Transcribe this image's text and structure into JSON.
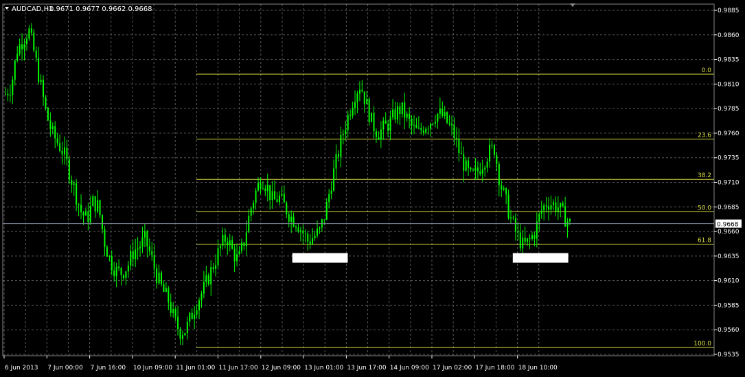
{
  "header": {
    "symbol": "AUDCAD,H1",
    "quote": "0.9671 0.9677 0.9662 0.9668"
  },
  "colors": {
    "background": "#000000",
    "grid": "#5a5a5a",
    "candles": "#00ff00",
    "fibo": "#e0e040",
    "axis_text": "#ffffff",
    "price_line": "#7d8a9a",
    "marker": "#ffffff"
  },
  "chart_data": {
    "type": "candlestick",
    "title": "",
    "ylim": [
      0.9535,
      0.9885
    ],
    "y_ticks": [
      "0.9885",
      "0.9860",
      "0.9835",
      "0.9810",
      "0.9785",
      "0.9760",
      "0.9735",
      "0.9710",
      "0.9685",
      "0.9660",
      "0.9635",
      "0.9610",
      "0.9585",
      "0.9560",
      "0.9535"
    ],
    "x_tick_labels": [
      "6 Jun 2013",
      "7 Jun 00:00",
      "7 Jun 16:00",
      "10 Jun 09:00",
      "11 Jun 01:00",
      "11 Jun 17:00",
      "12 Jun 09:00",
      "13 Jun 01:00",
      "13 Jun 17:00",
      "14 Jun 09:00",
      "17 Jun 02:00",
      "17 Jun 18:00",
      "18 Jun 10:00"
    ],
    "current_price": "0.9668",
    "price_path": [
      0.98,
      0.9808,
      0.9845,
      0.9855,
      0.9865,
      0.984,
      0.981,
      0.978,
      0.976,
      0.975,
      0.974,
      0.972,
      0.97,
      0.968,
      0.9672,
      0.969,
      0.9685,
      0.965,
      0.963,
      0.962,
      0.9618,
      0.9625,
      0.964,
      0.9645,
      0.9652,
      0.9635,
      0.9615,
      0.96,
      0.959,
      0.957,
      0.9558,
      0.956,
      0.9575,
      0.959,
      0.96,
      0.9615,
      0.963,
      0.9645,
      0.9655,
      0.964,
      0.963,
      0.965,
      0.968,
      0.97,
      0.9715,
      0.9705,
      0.969,
      0.9695,
      0.9685,
      0.9675,
      0.967,
      0.966,
      0.965,
      0.9655,
      0.966,
      0.968,
      0.971,
      0.9735,
      0.976,
      0.978,
      0.98,
      0.981,
      0.979,
      0.977,
      0.976,
      0.9765,
      0.977,
      0.978,
      0.9785,
      0.9775,
      0.9765,
      0.976,
      0.9768,
      0.9772,
      0.978,
      0.9778,
      0.977,
      0.976,
      0.974,
      0.9725,
      0.9715,
      0.972,
      0.973,
      0.974,
      0.9745,
      0.971,
      0.969,
      0.967,
      0.9655,
      0.9645,
      0.965,
      0.966,
      0.968,
      0.969,
      0.9688,
      0.9685,
      0.9675,
      0.9668
    ],
    "fibonacci": {
      "levels": [
        {
          "label": "0.0",
          "price": 0.982
        },
        {
          "label": "23.6",
          "price": 0.9754
        },
        {
          "label": "38.2",
          "price": 0.9713
        },
        {
          "label": "50.0",
          "price": 0.968
        },
        {
          "label": "61.8",
          "price": 0.9647
        },
        {
          "label": "100.0",
          "price": 0.9542
        }
      ]
    },
    "markers": [
      {
        "price": 0.9638,
        "x_start_fraction": 0.407,
        "x_end_fraction": 0.485
      },
      {
        "price": 0.9638,
        "x_start_fraction": 0.717,
        "x_end_fraction": 0.795
      }
    ]
  }
}
